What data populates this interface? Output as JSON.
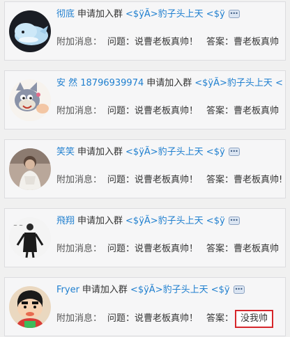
{
  "requests": [
    {
      "nickname": "彻底",
      "verb": "申请加入群",
      "group": "<$ÿÃ>豹子头上天 <$ÿ",
      "attach_label": "附加消息：",
      "question": "问题：说曹老板真帅！",
      "answer_label": "答案：",
      "answer": "曹老板真帅",
      "avatar_icon": "blue-whale-avatar"
    },
    {
      "nickname": "安 然 18796939974",
      "verb": "申请加入群",
      "group": "<$ÿÃ>豹子头上天 <$ÿ",
      "attach_label": "附加消息：",
      "question": "问题：说曹老板真帅！",
      "answer_label": "答案：",
      "answer": "曹老板真帅",
      "avatar_icon": "cartoon-cat-avatar"
    },
    {
      "nickname": "笑笑",
      "verb": "申请加入群",
      "group": "<$ÿÃ>豹子头上天 <$ÿ",
      "attach_label": "附加消息：",
      "question": "问题：说曹老板真帅！",
      "answer_label": "答案：",
      "answer": "曹老板真帅!",
      "avatar_icon": "person-photo-avatar"
    },
    {
      "nickname": "飛翔",
      "verb": "申请加入群",
      "group": "<$ÿÃ>豹子头上天 <$ÿ",
      "attach_label": "附加消息：",
      "question": "问题：说曹老板真帅！",
      "answer_label": "答案：",
      "answer": "曹老板真帅",
      "avatar_icon": "sketch-figure-avatar"
    },
    {
      "nickname": "Fryer",
      "verb": "申请加入群",
      "group": "<$ÿÃ>豹子头上天 <$ÿ",
      "attach_label": "附加消息：",
      "question": "问题：说曹老板真帅！",
      "answer_label": "答案：",
      "answer": "没我帅",
      "avatar_icon": "crayon-boy-avatar",
      "highlight_color": "#d6262b"
    }
  ],
  "colors": {
    "nickname": "#1f7fcf",
    "group": "#1f7fcf",
    "highlight_border": "#d6262b"
  },
  "icons": {
    "bubble": "speech-bubble-icon"
  }
}
